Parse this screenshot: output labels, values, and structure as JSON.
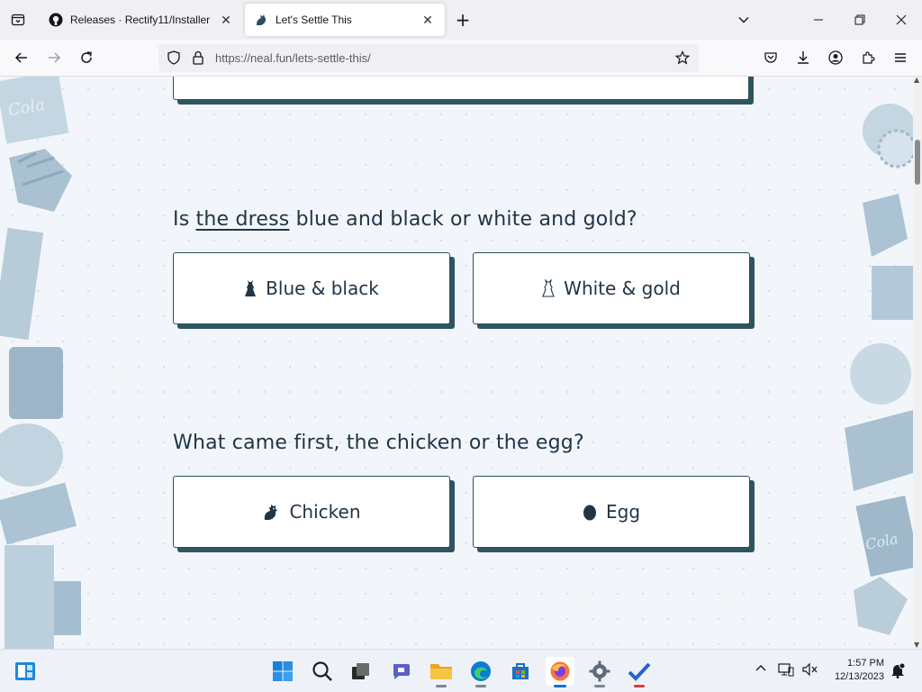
{
  "browser": {
    "tabs": [
      {
        "title": "Releases · Rectify11/Installer",
        "active": false
      },
      {
        "title": "Let's Settle This",
        "active": true
      }
    ],
    "url": "https://neal.fun/lets-settle-this/"
  },
  "questions": [
    {
      "prefix": "Is ",
      "link": "the dress",
      "suffix": " blue and black or white and gold?",
      "options": [
        {
          "label": "Blue & black",
          "icon": "dress-dark-icon"
        },
        {
          "label": "White & gold",
          "icon": "dress-light-icon"
        }
      ]
    },
    {
      "prefix": "What came first, the chicken or the egg?",
      "options": [
        {
          "label": "Chicken",
          "icon": "chicken-icon"
        },
        {
          "label": "Egg",
          "icon": "egg-icon"
        }
      ]
    }
  ],
  "taskbar": {
    "time": "1:57 PM",
    "date": "12/13/2023"
  },
  "colors": {
    "card_shadow": "#2e5560",
    "text": "#213547",
    "page_bg": "#f2f6fa"
  }
}
